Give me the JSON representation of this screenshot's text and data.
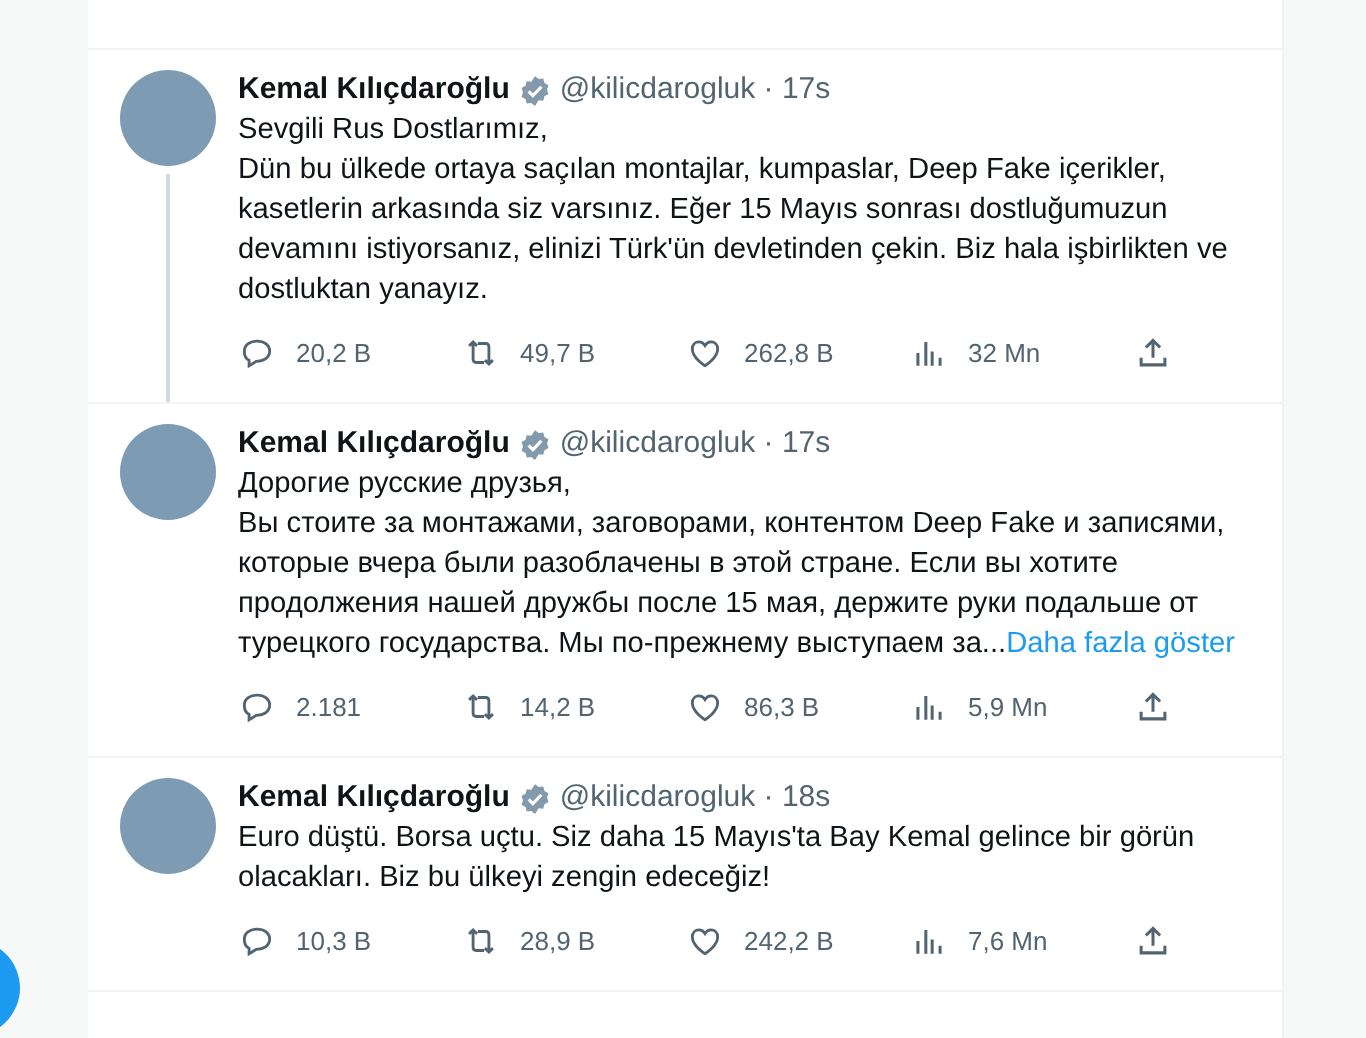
{
  "tweets": [
    {
      "name": "Kemal Kılıçdaroğlu",
      "verified": true,
      "meta": "@kilicdarogluk · 17s",
      "text": "Sevgili Rus Dostlarımız,\nDün bu ülkede ortaya saçılan montajlar, kumpaslar, Deep Fake içerikler, kasetlerin arkasında siz varsınız. Eğer 15 Mayıs sonrası dostluğumuzun devamını istiyorsanız, elinizi Türk'ün devletinden çekin. Biz hala işbirlikten ve dostluktan yanayız.",
      "connected": true,
      "stats": [
        {
          "kind": "reply",
          "value": "20,2 B"
        },
        {
          "kind": "retweet",
          "value": "49,7 B"
        },
        {
          "kind": "like",
          "value": "262,8 B"
        },
        {
          "kind": "views",
          "value": "32 Mn"
        },
        {
          "kind": "share"
        }
      ]
    },
    {
      "name": "Kemal Kılıçdaroğlu",
      "verified": true,
      "meta": "@kilicdarogluk · 17s",
      "text": "Дорогие русские друзья,\nВы стоите за монтажами, заговорами, контентом Deep Fake и записями, которые вчера были разоблачены в этой стране. Если вы хотите продолжения нашей дружбы после 15 мая, держите руки подальше от турецкого государства. Мы по-прежнему выступаем за...",
      "more": "Daha fazla göster",
      "connected": false,
      "stats": [
        {
          "kind": "reply",
          "value": "2.181"
        },
        {
          "kind": "retweet",
          "value": "14,2 B"
        },
        {
          "kind": "like",
          "value": "86,3 B"
        },
        {
          "kind": "views",
          "value": "5,9 Mn"
        },
        {
          "kind": "share"
        }
      ]
    },
    {
      "name": "Kemal Kılıçdaroğlu",
      "verified": true,
      "meta": "@kilicdarogluk · 18s",
      "text": "Euro düştü. Borsa uçtu. Siz daha 15 Mayıs'ta Bay Kemal gelince bir görün olacakları. Biz bu ülkeyi zengin edeceğiz!",
      "connected": false,
      "stats": [
        {
          "kind": "reply",
          "value": "10,3 B"
        },
        {
          "kind": "retweet",
          "value": "28,9 B"
        },
        {
          "kind": "like",
          "value": "242,2 B"
        },
        {
          "kind": "views",
          "value": "7,6 Mn"
        },
        {
          "kind": "share"
        }
      ]
    }
  ]
}
